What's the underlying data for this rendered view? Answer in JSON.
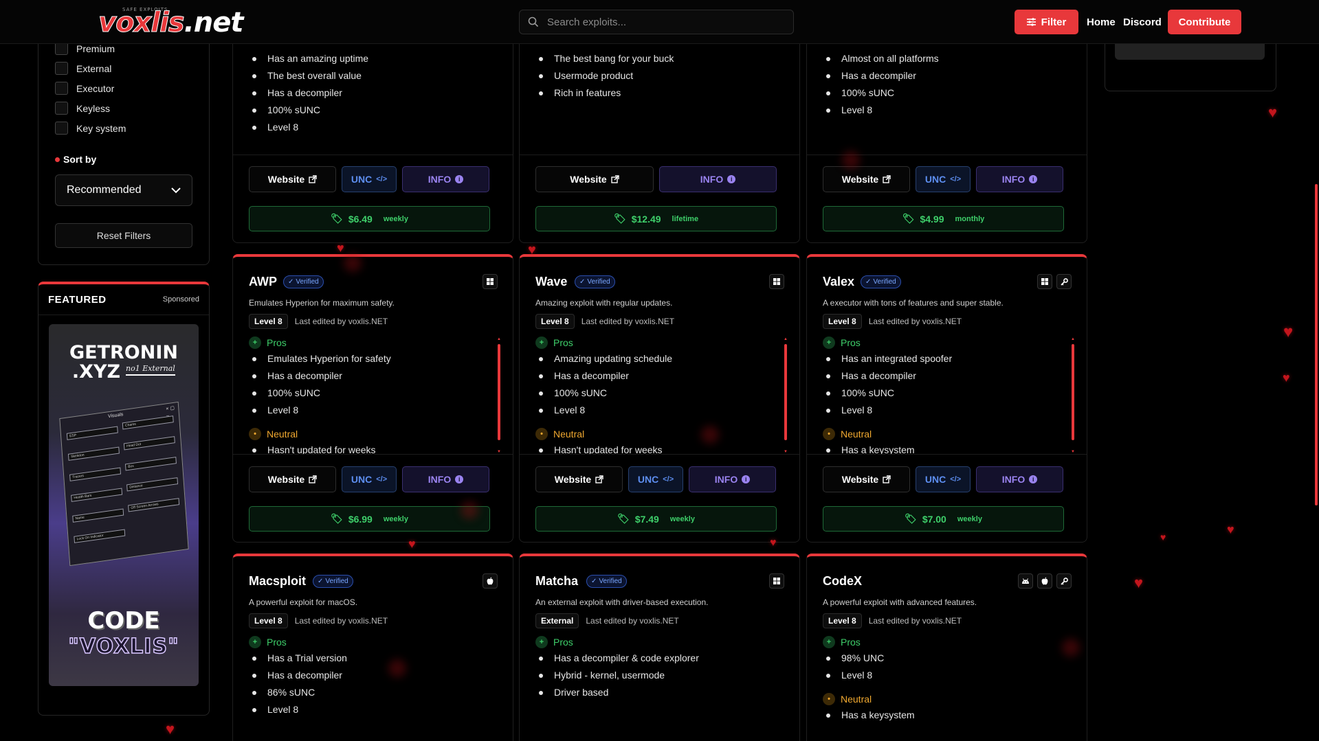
{
  "header": {
    "logo_text": "voxlis",
    "logo_tld": ".net",
    "logo_small": "SAFE EXPLOITS",
    "search_placeholder": "Search exploits...",
    "filter_label": "Filter",
    "nav_home": "Home",
    "nav_discord": "Discord",
    "contribute_label": "Contribute"
  },
  "sidebar": {
    "filters": [
      "Premium",
      "External",
      "Executor",
      "Keyless",
      "Key system"
    ],
    "sort_title": "Sort by",
    "sort_value": "Recommended",
    "reset_label": "Reset Filters",
    "featured_title": "FEATURED",
    "sponsored_label": "Sponsored",
    "ad": {
      "brand_line1": "GETRONIN",
      "brand_line2": ".XYZ",
      "brand_tagline": "no1 External",
      "window_title": "Visuals",
      "rows": [
        "ESP",
        "Chams",
        "Skeleton",
        "Head Dot",
        "Tracers",
        "Box",
        "Health Bars",
        "Distance",
        "Name",
        "Off Screen Arrows",
        "Lock On Indicator"
      ],
      "code_label": "CODE",
      "code_value": "\"VOXLIS\""
    }
  },
  "cards_top": [
    {
      "pros": [
        "Has an amazing uptime",
        "The best overall value",
        "Has a decompiler",
        "100% sUNC",
        "Level 8"
      ],
      "buttons": [
        "Website",
        "UNC",
        "INFO"
      ],
      "price": "$6.49",
      "period": "weekly"
    },
    {
      "pros": [
        "The best bang for your buck",
        "Usermode product",
        "Rich in features"
      ],
      "buttons": [
        "Website",
        "INFO"
      ],
      "price": "$12.49",
      "period": "lifetime"
    },
    {
      "pros": [
        "Almost on all platforms",
        "Has a decompiler",
        "100% sUNC",
        "Level 8"
      ],
      "buttons": [
        "Website",
        "UNC",
        "INFO"
      ],
      "price": "$4.99",
      "period": "monthly"
    }
  ],
  "cards_mid": [
    {
      "name": "AWP",
      "verified": "Verified",
      "desc": "Emulates Hyperion for maximum safety.",
      "level": "Level 8",
      "edited": "Last edited by voxlis.NET",
      "platforms": [
        "windows-icon"
      ],
      "pros_label": "Pros",
      "pros": [
        "Emulates Hyperion for safety",
        "Has a decompiler",
        "100% sUNC",
        "Level 8"
      ],
      "neutral_label": "Neutral",
      "neutral": [
        "Hasn't updated for weeks"
      ],
      "buttons": [
        "Website",
        "UNC",
        "INFO"
      ],
      "price": "$6.99",
      "period": "weekly"
    },
    {
      "name": "Wave",
      "verified": "Verified",
      "desc": "Amazing exploit with regular updates.",
      "level": "Level 8",
      "edited": "Last edited by voxlis.NET",
      "platforms": [
        "windows-icon"
      ],
      "pros_label": "Pros",
      "pros": [
        "Amazing updating schedule",
        "Has a decompiler",
        "100% sUNC",
        "Level 8"
      ],
      "neutral_label": "Neutral",
      "neutral": [
        "Hasn't updated for weeks"
      ],
      "buttons": [
        "Website",
        "UNC",
        "INFO"
      ],
      "price": "$7.49",
      "period": "weekly"
    },
    {
      "name": "Valex",
      "verified": "Verified",
      "desc": "A executor with tons of features and super stable.",
      "level": "Level 8",
      "edited": "Last edited by voxlis.NET",
      "platforms": [
        "windows-icon",
        "key-icon"
      ],
      "pros_label": "Pros",
      "pros": [
        "Has an integrated spoofer",
        "Has a decompiler",
        "100% sUNC",
        "Level 8"
      ],
      "neutral_label": "Neutral",
      "neutral": [
        "Has a keysystem"
      ],
      "buttons": [
        "Website",
        "UNC",
        "INFO"
      ],
      "price": "$7.00",
      "period": "weekly"
    }
  ],
  "cards_bottom": [
    {
      "name": "Macsploit",
      "verified": "Verified",
      "desc": "A powerful exploit for macOS.",
      "level": "Level 8",
      "edited": "Last edited by voxlis.NET",
      "platforms": [
        "apple-icon"
      ],
      "pros_label": "Pros",
      "pros": [
        "Has a Trial version",
        "Has a decompiler",
        "86% sUNC",
        "Level 8"
      ]
    },
    {
      "name": "Matcha",
      "verified": "Verified",
      "desc": "An external exploit with driver-based execution.",
      "level": "External",
      "edited": "Last edited by voxlis.NET",
      "platforms": [
        "windows-icon"
      ],
      "pros_label": "Pros",
      "pros": [
        "Has a decompiler & code explorer",
        "Hybrid - kernel, usermode",
        "Driver based"
      ]
    },
    {
      "name": "CodeX",
      "verified": "",
      "desc": "A powerful exploit with advanced features.",
      "level": "Level 8",
      "edited": "Last edited by voxlis.NET",
      "platforms": [
        "android-icon",
        "apple-icon",
        "key-icon"
      ],
      "pros_label": "Pros",
      "pros": [
        "98% UNC",
        "Level 8"
      ],
      "neutral_label": "Neutral",
      "neutral": [
        "Has a keysystem"
      ]
    }
  ],
  "colors": {
    "accent": "#e8383b",
    "pros": "#3ecf6a",
    "neutral": "#f0a830",
    "unc": "#5d8ef0",
    "info": "#9a83f0",
    "verified": "#7aa7ff"
  }
}
